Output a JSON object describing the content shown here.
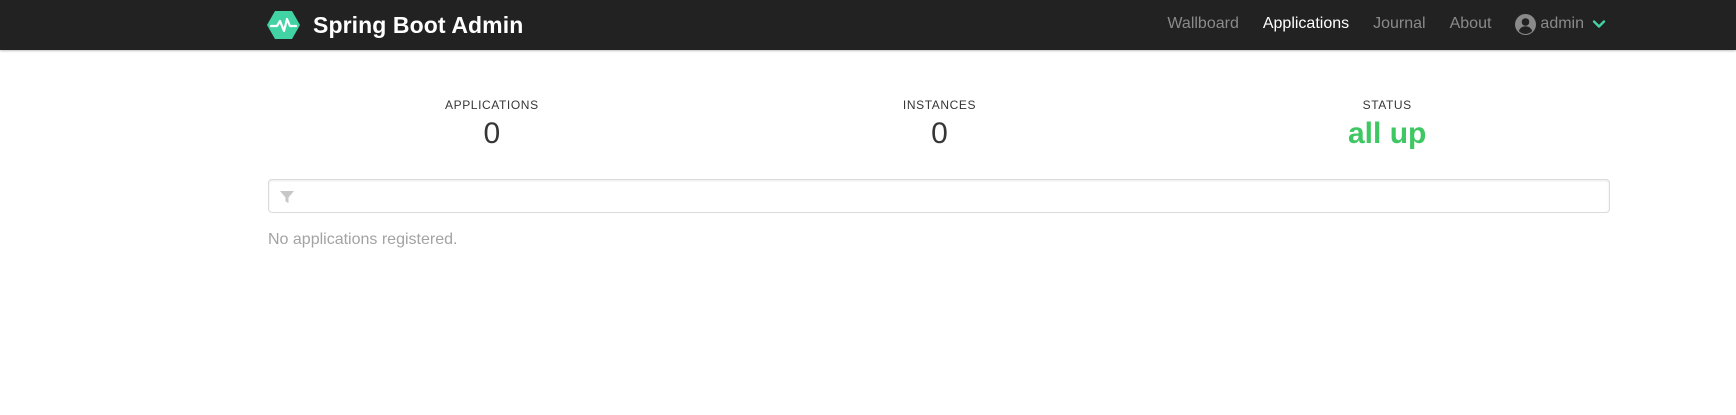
{
  "app": {
    "title": "Spring Boot Admin",
    "logo_icon": "heartbeat-hexagon-icon",
    "accent_color": "#42d3a5"
  },
  "nav": {
    "items": [
      {
        "label": "Wallboard",
        "active": false
      },
      {
        "label": "Applications",
        "active": true
      },
      {
        "label": "Journal",
        "active": false
      },
      {
        "label": "About",
        "active": false
      }
    ],
    "user": {
      "name": "admin",
      "icon": "user-circle-icon",
      "dropdown_icon": "chevron-down-icon"
    }
  },
  "stats": {
    "applications": {
      "label": "APPLICATIONS",
      "value": "0"
    },
    "instances": {
      "label": "INSTANCES",
      "value": "0"
    },
    "status": {
      "label": "STATUS",
      "value": "all up",
      "color": "#3ec762"
    }
  },
  "filter": {
    "icon": "filter-icon",
    "value": "",
    "placeholder": ""
  },
  "empty_message": "No applications registered."
}
